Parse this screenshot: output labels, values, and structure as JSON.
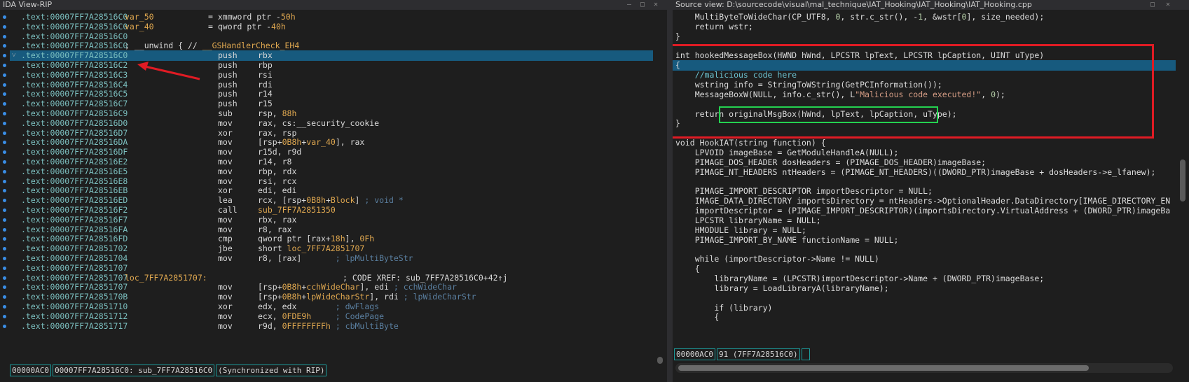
{
  "ida": {
    "title": "IDA View-RIP",
    "lines": [
      {
        "addr": ".text:00007FF7A28516C0",
        "segs": [
          [
            "label",
            "var_50"
          ],
          [
            "ops",
            "= xmmword ptr -"
          ],
          [
            "num",
            "50h"
          ]
        ]
      },
      {
        "addr": ".text:00007FF7A28516C0",
        "segs": [
          [
            "label",
            "var_40"
          ],
          [
            "ops",
            "= qword ptr -"
          ],
          [
            "num",
            "40h"
          ]
        ]
      },
      {
        "addr": ".text:00007FF7A28516C0",
        "segs": []
      },
      {
        "addr": ".text:00007FF7A28516C0",
        "segs": [
          [
            "raw",
            "; __unwind { // "
          ],
          [
            "rawlink",
            "__GSHandlerCheck_EH4"
          ]
        ]
      },
      {
        "addr": ".text:00007FF7A28516C0",
        "mnem": "push",
        "segs": [
          [
            "ops",
            "rbx"
          ]
        ],
        "selected": true,
        "fold": true
      },
      {
        "addr": ".text:00007FF7A28516C2",
        "mnem": "push",
        "segs": [
          [
            "ops",
            "rbp"
          ]
        ]
      },
      {
        "addr": ".text:00007FF7A28516C3",
        "mnem": "push",
        "segs": [
          [
            "ops",
            "rsi"
          ]
        ]
      },
      {
        "addr": ".text:00007FF7A28516C4",
        "mnem": "push",
        "segs": [
          [
            "ops",
            "rdi"
          ]
        ]
      },
      {
        "addr": ".text:00007FF7A28516C5",
        "mnem": "push",
        "segs": [
          [
            "ops",
            "r14"
          ]
        ]
      },
      {
        "addr": ".text:00007FF7A28516C7",
        "mnem": "push",
        "segs": [
          [
            "ops",
            "r15"
          ]
        ]
      },
      {
        "addr": ".text:00007FF7A28516C9",
        "mnem": "sub",
        "segs": [
          [
            "ops",
            "rsp, "
          ],
          [
            "num",
            "88h"
          ]
        ]
      },
      {
        "addr": ".text:00007FF7A28516D0",
        "mnem": "mov",
        "segs": [
          [
            "ops",
            "rax, cs:__security_cookie"
          ]
        ]
      },
      {
        "addr": ".text:00007FF7A28516D7",
        "mnem": "xor",
        "segs": [
          [
            "ops",
            "rax, rsp"
          ]
        ]
      },
      {
        "addr": ".text:00007FF7A28516DA",
        "mnem": "mov",
        "segs": [
          [
            "ops",
            "[rsp+"
          ],
          [
            "num",
            "0B8h"
          ],
          [
            "ops",
            "+"
          ],
          [
            "num",
            "var_40"
          ],
          [
            "ops",
            "], rax"
          ]
        ]
      },
      {
        "addr": ".text:00007FF7A28516DF",
        "mnem": "mov",
        "segs": [
          [
            "ops",
            "r15d, r9d"
          ]
        ]
      },
      {
        "addr": ".text:00007FF7A28516E2",
        "mnem": "mov",
        "segs": [
          [
            "ops",
            "r14, r8"
          ]
        ]
      },
      {
        "addr": ".text:00007FF7A28516E5",
        "mnem": "mov",
        "segs": [
          [
            "ops",
            "rbp, rdx"
          ]
        ]
      },
      {
        "addr": ".text:00007FF7A28516E8",
        "mnem": "mov",
        "segs": [
          [
            "ops",
            "rsi, rcx"
          ]
        ]
      },
      {
        "addr": ".text:00007FF7A28516EB",
        "mnem": "xor",
        "segs": [
          [
            "ops",
            "edi, edi"
          ]
        ]
      },
      {
        "addr": ".text:00007FF7A28516ED",
        "mnem": "lea",
        "segs": [
          [
            "ops",
            "rcx, [rsp+"
          ],
          [
            "num",
            "0B8h"
          ],
          [
            "ops",
            "+"
          ],
          [
            "num",
            "Block"
          ],
          [
            "ops",
            "] "
          ],
          [
            "ann",
            "; void *"
          ]
        ]
      },
      {
        "addr": ".text:00007FF7A28516F2",
        "mnem": "call",
        "segs": [
          [
            "num",
            "sub_7FF7A2851350"
          ]
        ]
      },
      {
        "addr": ".text:00007FF7A28516F7",
        "mnem": "mov",
        "segs": [
          [
            "ops",
            "rbx, rax"
          ]
        ]
      },
      {
        "addr": ".text:00007FF7A28516FA",
        "mnem": "mov",
        "segs": [
          [
            "ops",
            "r8, rax"
          ]
        ]
      },
      {
        "addr": ".text:00007FF7A28516FD",
        "mnem": "cmp",
        "segs": [
          [
            "ops",
            "qword ptr [rax+"
          ],
          [
            "num",
            "18h"
          ],
          [
            "ops",
            "], "
          ],
          [
            "num",
            "0Fh"
          ]
        ]
      },
      {
        "addr": ".text:00007FF7A2851702",
        "mnem": "jbe",
        "segs": [
          [
            "ops",
            "short "
          ],
          [
            "num",
            "loc_7FF7A2851707"
          ]
        ]
      },
      {
        "addr": ".text:00007FF7A2851704",
        "mnem": "mov",
        "segs": [
          [
            "ops",
            "r8, [rax]       "
          ],
          [
            "ann",
            "; lpMultiByteStr"
          ]
        ]
      },
      {
        "addr": ".text:00007FF7A2851707",
        "segs": []
      },
      {
        "addr": ".text:00007FF7A2851707",
        "label": "loc_7FF7A2851707:",
        "xref": "; CODE XREF: sub_7FF7A28516C0+42↑j",
        "segs": []
      },
      {
        "addr": ".text:00007FF7A2851707",
        "mnem": "mov",
        "segs": [
          [
            "ops",
            "[rsp+"
          ],
          [
            "num",
            "0B8h"
          ],
          [
            "ops",
            "+"
          ],
          [
            "num",
            "cchWideChar"
          ],
          [
            "ops",
            "], edi "
          ],
          [
            "ann",
            "; cchWideChar"
          ]
        ]
      },
      {
        "addr": ".text:00007FF7A285170B",
        "mnem": "mov",
        "segs": [
          [
            "ops",
            "[rsp+"
          ],
          [
            "num",
            "0B8h"
          ],
          [
            "ops",
            "+"
          ],
          [
            "num",
            "lpWideCharStr"
          ],
          [
            "ops",
            "], rdi "
          ],
          [
            "ann",
            "; lpWideCharStr"
          ]
        ]
      },
      {
        "addr": ".text:00007FF7A2851710",
        "mnem": "xor",
        "segs": [
          [
            "ops",
            "edx, edx        "
          ],
          [
            "ann",
            "; dwFlags"
          ]
        ]
      },
      {
        "addr": ".text:00007FF7A2851712",
        "mnem": "mov",
        "segs": [
          [
            "ops",
            "ecx, "
          ],
          [
            "num",
            "0FDE9h"
          ],
          [
            "ops",
            "     "
          ],
          [
            "ann",
            "; CodePage"
          ]
        ]
      },
      {
        "addr": ".text:00007FF7A2851717",
        "mnem": "mov",
        "segs": [
          [
            "ops",
            "r9d, "
          ],
          [
            "num",
            "0FFFFFFFFh"
          ],
          [
            "ops",
            " "
          ],
          [
            "ann",
            "; cbMultiByte"
          ]
        ]
      }
    ],
    "status": [
      "00000AC0",
      "00007FF7A28516C0: sub_7FF7A28516C0",
      "(Synchronized with RIP)"
    ]
  },
  "source": {
    "title": "Source view: D:\\sourcecode\\visual\\mal_technique\\IAT_Hooking\\IAT_Hooking\\IAT_Hooking.cpp",
    "lines": [
      [
        [
          "t",
          "    MultiByteToWideChar(CP_UTF8, "
        ],
        [
          "n",
          "0"
        ],
        [
          "t",
          ", str.c_str(), -"
        ],
        [
          "n",
          "1"
        ],
        [
          "t",
          ", &wstr["
        ],
        [
          "n",
          "0"
        ],
        [
          "t",
          "], size_needed);"
        ]
      ],
      [
        [
          "t",
          "    return wstr;"
        ]
      ],
      [
        [
          "t",
          "}"
        ]
      ],
      [
        [
          "t",
          ""
        ]
      ],
      [
        [
          "t",
          "int hookedMessageBox(HWND hWnd, LPCSTR lpText, LPCSTR lpCaption, UINT uType)"
        ]
      ],
      [
        [
          "t",
          "{"
        ]
      ],
      [
        [
          "c",
          "    //malicious code here"
        ]
      ],
      [
        [
          "t",
          "    wstring info = StringToWString(GetPCInformation());"
        ]
      ],
      [
        [
          "t",
          "    MessageBoxW(NULL, info.c_str(), L"
        ],
        [
          "s",
          "\"Malicious code executed!\""
        ],
        [
          "t",
          ", "
        ],
        [
          "n",
          "0"
        ],
        [
          "t",
          ");"
        ]
      ],
      [
        [
          "t",
          ""
        ]
      ],
      [
        [
          "t",
          "    return originalMsgBox(hWnd, lpText, lpCaption, uType);"
        ]
      ],
      [
        [
          "t",
          "}"
        ]
      ],
      [
        [
          "t",
          ""
        ]
      ],
      [
        [
          "t",
          "void HookIAT(string function) {"
        ]
      ],
      [
        [
          "t",
          "    LPVOID imageBase = GetModuleHandleA(NULL);"
        ]
      ],
      [
        [
          "t",
          "    PIMAGE_DOS_HEADER dosHeaders = (PIMAGE_DOS_HEADER)imageBase;"
        ]
      ],
      [
        [
          "t",
          "    PIMAGE_NT_HEADERS ntHeaders = (PIMAGE_NT_HEADERS)((DWORD_PTR)imageBase + dosHeaders->e_lfanew);"
        ]
      ],
      [
        [
          "t",
          ""
        ]
      ],
      [
        [
          "t",
          "    PIMAGE_IMPORT_DESCRIPTOR importDescriptor = NULL;"
        ]
      ],
      [
        [
          "t",
          "    IMAGE_DATA_DIRECTORY importsDirectory = ntHeaders->OptionalHeader.DataDirectory[IMAGE_DIRECTORY_EN"
        ]
      ],
      [
        [
          "t",
          "    importDescriptor = (PIMAGE_IMPORT_DESCRIPTOR)(importsDirectory.VirtualAddress + (DWORD_PTR)imageBa"
        ]
      ],
      [
        [
          "t",
          "    LPCSTR libraryName = NULL;"
        ]
      ],
      [
        [
          "t",
          "    HMODULE library = NULL;"
        ]
      ],
      [
        [
          "t",
          "    PIMAGE_IMPORT_BY_NAME functionName = NULL;"
        ]
      ],
      [
        [
          "t",
          ""
        ]
      ],
      [
        [
          "t",
          "    while (importDescriptor->Name != NULL)"
        ]
      ],
      [
        [
          "t",
          "    {"
        ]
      ],
      [
        [
          "t",
          "        libraryName = (LPCSTR)importDescriptor->Name + (DWORD_PTR)imageBase;"
        ]
      ],
      [
        [
          "t",
          "        library = LoadLibraryA(libraryName);"
        ]
      ],
      [
        [
          "t",
          ""
        ]
      ],
      [
        [
          "t",
          "        if (library)"
        ]
      ],
      [
        [
          "t",
          "        {"
        ]
      ]
    ],
    "current_line": 5,
    "status": [
      "00000AC0",
      "91 (7FF7A28516C0)",
      ""
    ]
  },
  "colors": {
    "annotation_red": "#e01b24",
    "annotation_green": "#24d150",
    "selection": "#175a7e",
    "status_border": "#1c9a9a"
  }
}
